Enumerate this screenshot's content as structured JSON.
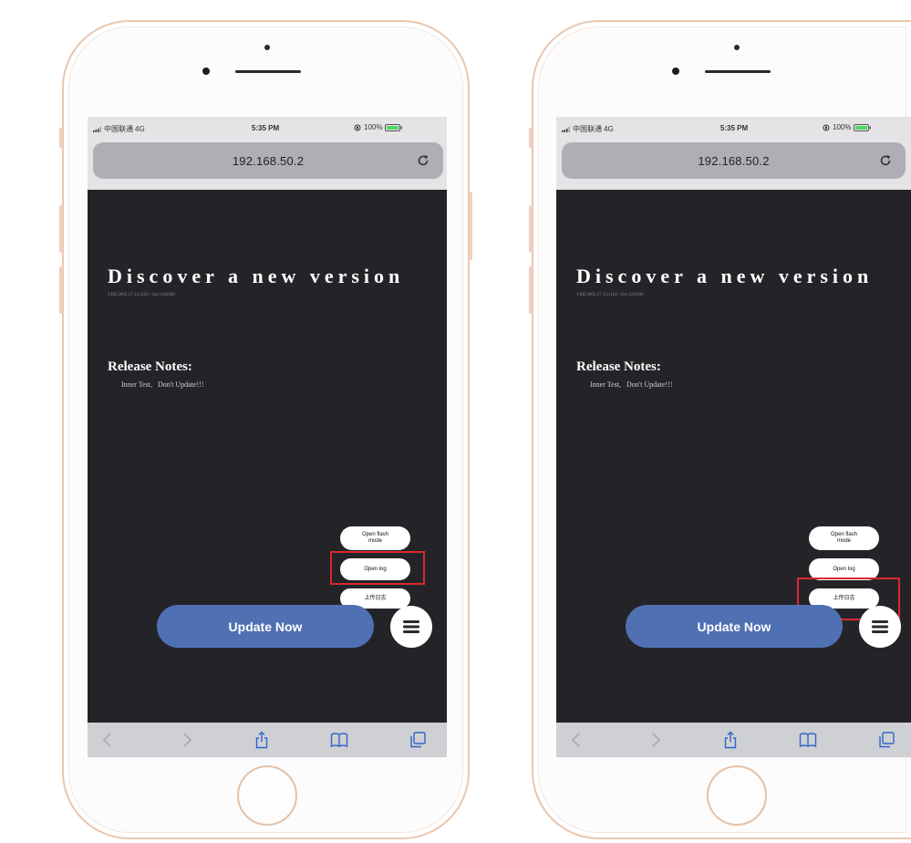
{
  "phones": [
    {
      "status": {
        "carrier": "中国联通",
        "network": "4G",
        "time": "5:35 PM",
        "battery": "100%"
      },
      "browser": {
        "url": "192.168.50.2"
      },
      "page": {
        "title": "Discover a new version",
        "version": "VER:2005.17.13.1102 / Sec:4.05606",
        "release_title": "Release Notes:",
        "release_notes": "Inner Test,   Don't Update!!!",
        "menu": [
          "Open flash mode",
          "Open log",
          "上传日志"
        ],
        "update_button": "Update Now"
      }
    },
    {
      "status": {
        "carrier": "中国联通",
        "network": "4G",
        "time": "5:35 PM",
        "battery": "100%"
      },
      "browser": {
        "url": "192.168.50.2"
      },
      "page": {
        "title": "Discover a new version",
        "version": "VER:2005.17.13.1102 / Sec:4.05606",
        "release_title": "Release Notes:",
        "release_notes": "Inner Test,   Don't Update!!!",
        "menu": [
          "Open flash mode",
          "Open log",
          "上传日志"
        ],
        "update_button": "Update Now"
      }
    }
  ],
  "colors": {
    "page_background": "#242428",
    "update_button": "#4f70b3",
    "highlight_box": "#d9282f",
    "toolbar_icon": "#2f66c9",
    "phone_frame": "#e9c7af"
  },
  "icons": {
    "status": [
      "signal-icon",
      "orientation-lock-icon",
      "battery-icon"
    ],
    "address_bar": "reload-icon",
    "toolbar": [
      "back-icon",
      "forward-icon",
      "share-icon",
      "bookmarks-icon",
      "tabs-icon"
    ],
    "floating": "hamburger-menu-icon"
  }
}
